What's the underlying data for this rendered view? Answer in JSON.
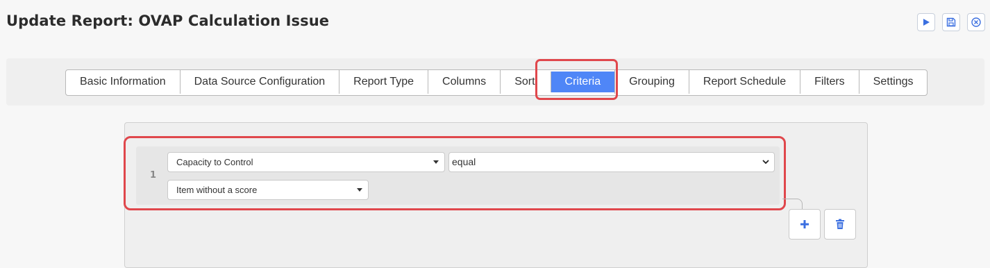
{
  "page": {
    "title": "Update Report: OVAP Calculation Issue"
  },
  "actions": {
    "run_icon": "play-icon",
    "save_icon": "save-icon",
    "close_icon": "close-circle-icon",
    "accent": "#3b6fe0"
  },
  "tabs": [
    {
      "label": "Basic Information",
      "active": false
    },
    {
      "label": "Data Source Configuration",
      "active": false
    },
    {
      "label": "Report Type",
      "active": false
    },
    {
      "label": "Columns",
      "active": false
    },
    {
      "label": "Sort",
      "active": false
    },
    {
      "label": "Criteria",
      "active": true
    },
    {
      "label": "Grouping",
      "active": false
    },
    {
      "label": "Report Schedule",
      "active": false
    },
    {
      "label": "Filters",
      "active": false
    },
    {
      "label": "Settings",
      "active": false
    }
  ],
  "criteria": {
    "rows": [
      {
        "number": "1",
        "field": "Capacity to Control",
        "operator": "equal",
        "value": "Item without a score"
      }
    ],
    "add_icon": "plus-icon",
    "delete_icon": "trash-icon"
  },
  "colors": {
    "active_tab": "#4f86f7",
    "highlight": "#e0474c"
  }
}
